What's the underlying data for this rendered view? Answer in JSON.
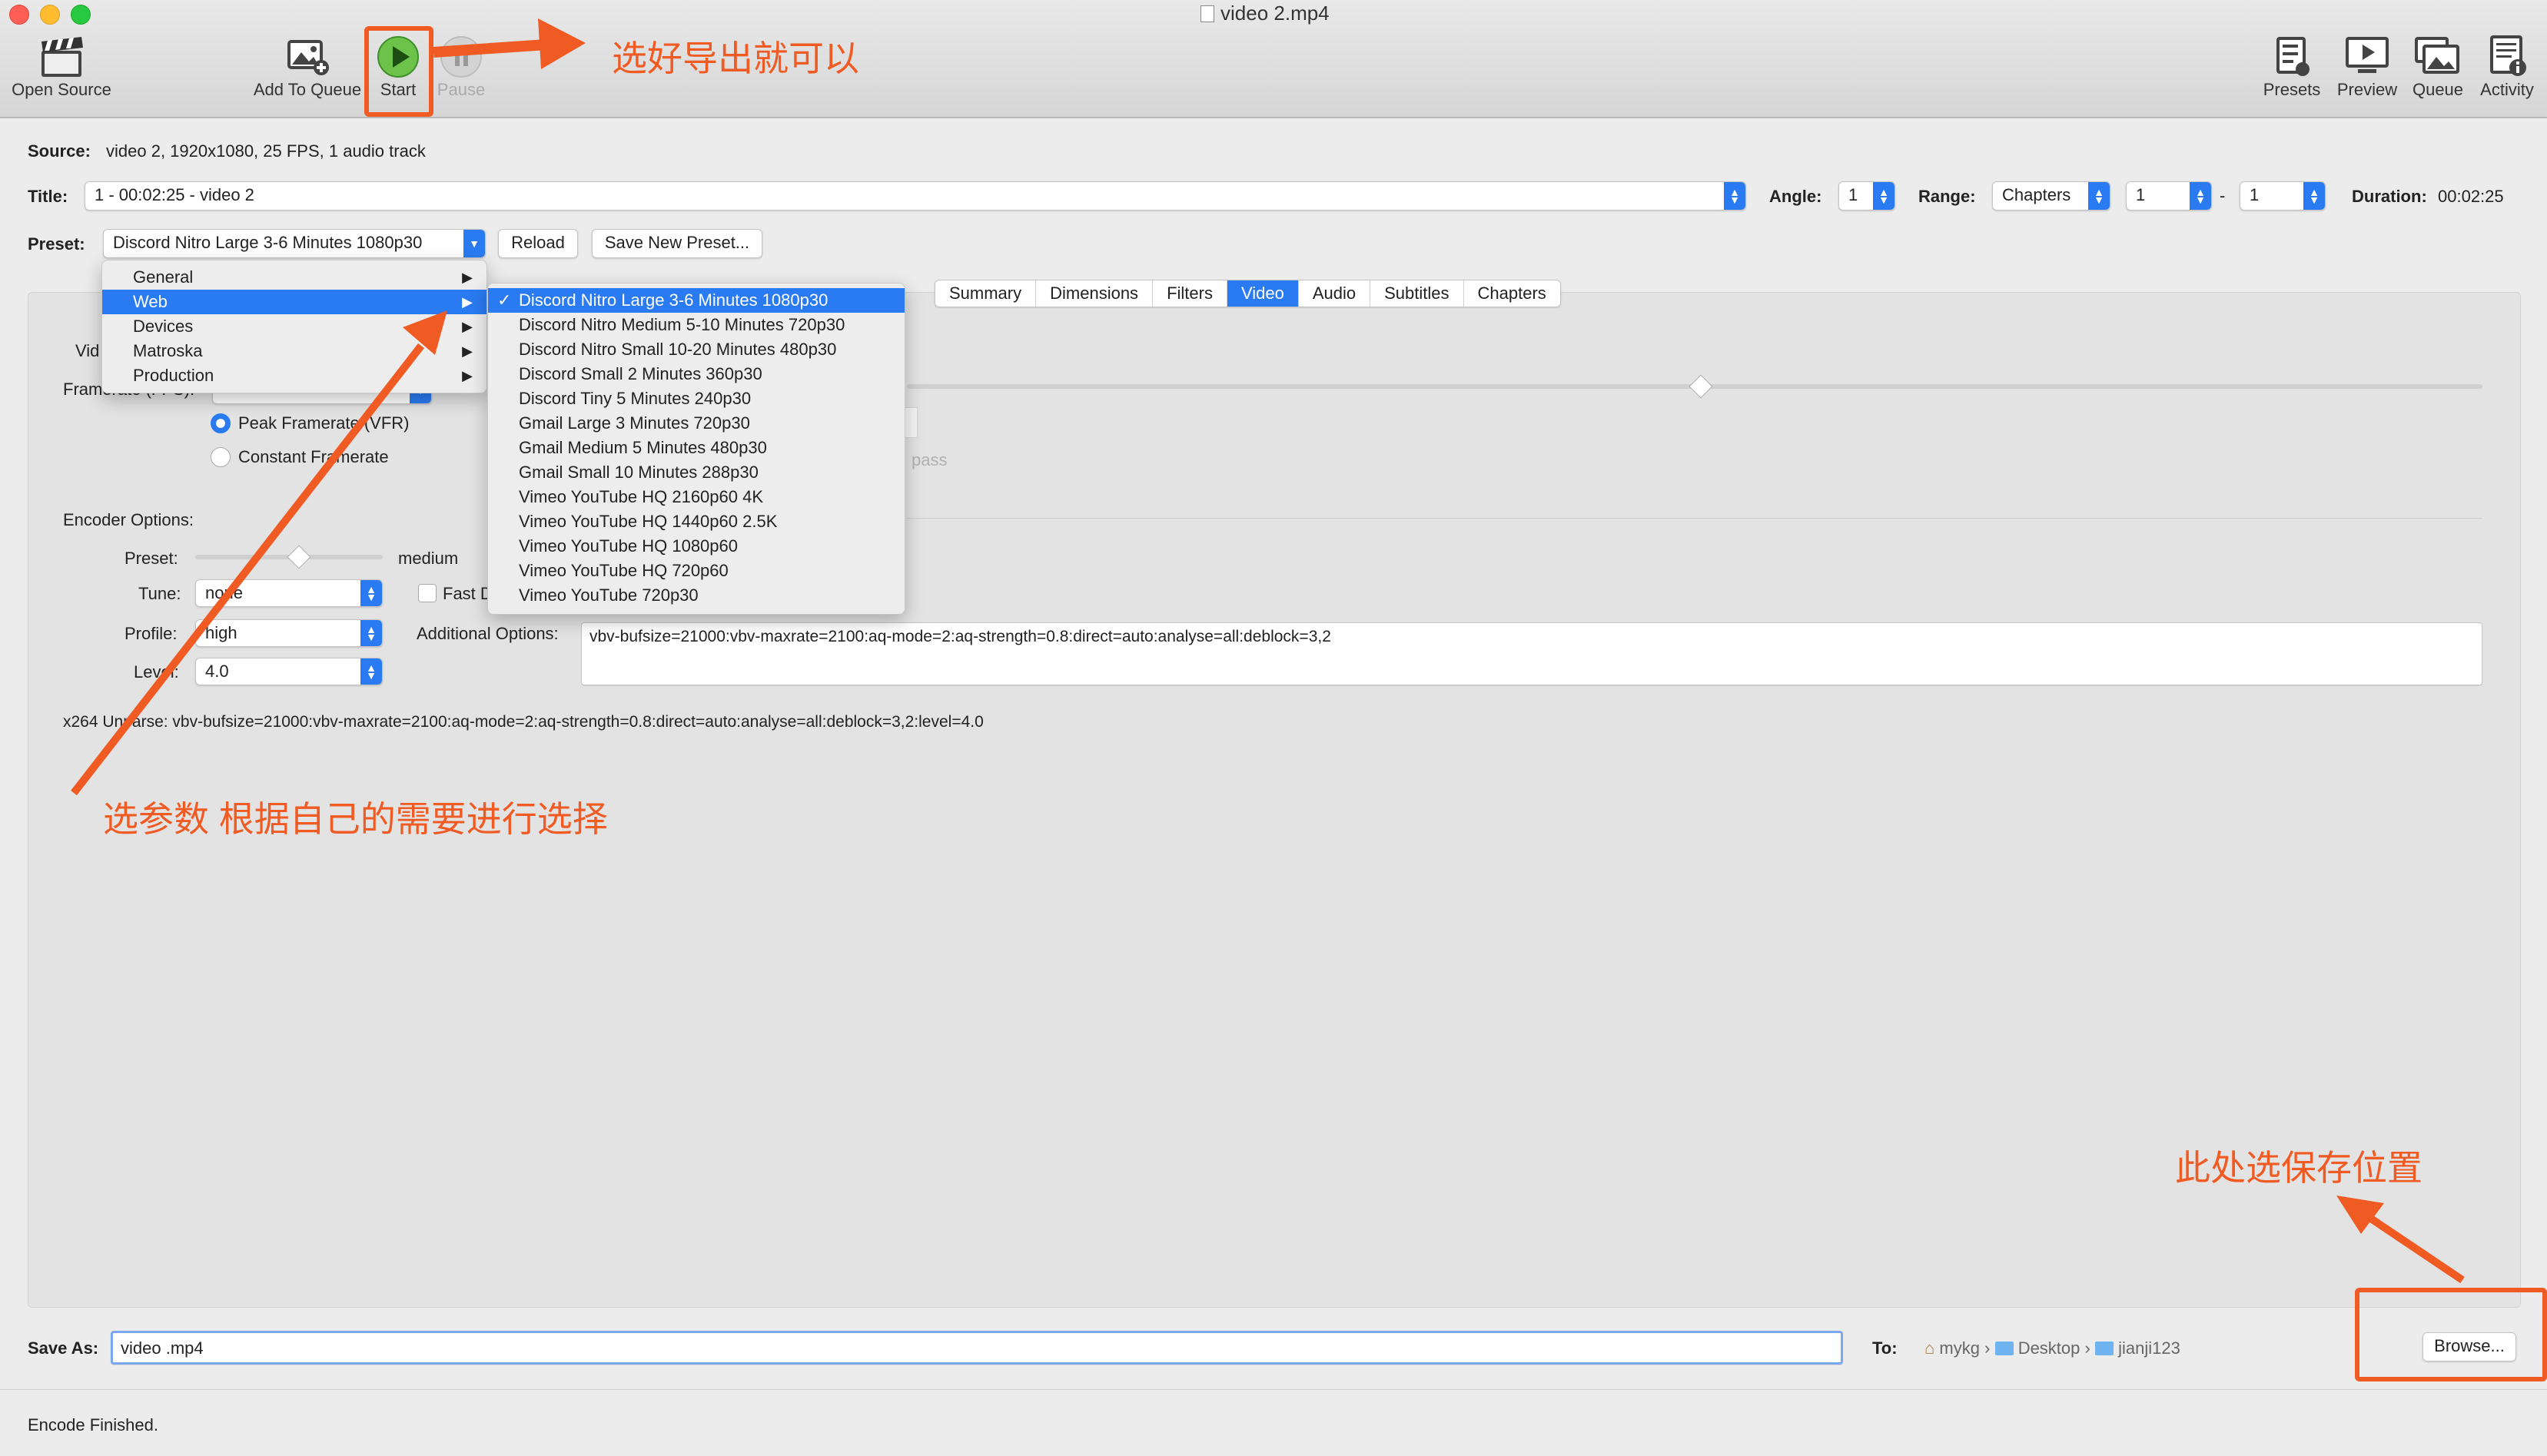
{
  "window": {
    "title": "video 2.mp4"
  },
  "toolbar": {
    "open_source": "Open Source",
    "add_to_queue": "Add To Queue",
    "start": "Start",
    "pause": "Pause",
    "presets": "Presets",
    "preview": "Preview",
    "queue": "Queue",
    "activity": "Activity"
  },
  "source": {
    "label": "Source:",
    "value": "video 2, 1920x1080, 25 FPS, 1 audio track"
  },
  "title_row": {
    "label": "Title:",
    "value": "1 - 00:02:25 - video 2",
    "angle_label": "Angle:",
    "angle_value": "1",
    "range_label": "Range:",
    "range_type": "Chapters",
    "range_from": "1",
    "range_dash": "-",
    "range_to": "1",
    "duration_label": "Duration:",
    "duration_value": "00:02:25"
  },
  "preset_row": {
    "label": "Preset:",
    "value": "Discord Nitro Large 3-6 Minutes 1080p30",
    "reload": "Reload",
    "save_new": "Save New Preset..."
  },
  "tabs": [
    "Summary",
    "Dimensions",
    "Filters",
    "Video",
    "Audio",
    "Subtitles",
    "Chapters"
  ],
  "selected_tab": "Video",
  "video_tab": {
    "video_label_partial": "Vid",
    "framerate_label_partial": "Framerate (FPS):",
    "peak_framerate": "Peak Framerate (VFR)",
    "constant_framerate": "Constant Framerate",
    "pass_partial": "pass",
    "encoder_options": "Encoder Options:",
    "preset_label": "Preset:",
    "preset_value": "medium",
    "tune_label": "Tune:",
    "tune_value": "none",
    "fast_decode_partial": "Fast D",
    "profile_label": "Profile:",
    "profile_value": "high",
    "additional_label": "Additional Options:",
    "additional_value": "vbv-bufsize=21000:vbv-maxrate=2100:aq-mode=2:aq-strength=0.8:direct=auto:analyse=all:deblock=3,2",
    "level_label": "Level:",
    "level_value": "4.0",
    "unparse": "x264 Unparse: vbv-bufsize=21000:vbv-maxrate=2100:aq-mode=2:aq-strength=0.8:direct=auto:analyse=all:deblock=3,2:level=4.0"
  },
  "preset_menu": {
    "categories": [
      "General",
      "Web",
      "Devices",
      "Matroska",
      "Production"
    ],
    "selected_category": "Web",
    "web_items": [
      "Discord Nitro Large 3-6 Minutes 1080p30",
      "Discord Nitro Medium 5-10 Minutes 720p30",
      "Discord Nitro Small 10-20 Minutes 480p30",
      "Discord Small 2 Minutes 360p30",
      "Discord Tiny 5 Minutes 240p30",
      "Gmail Large 3 Minutes 720p30",
      "Gmail Medium 5 Minutes 480p30",
      "Gmail Small 10 Minutes 288p30",
      "Vimeo YouTube HQ 2160p60 4K",
      "Vimeo YouTube HQ 1440p60 2.5K",
      "Vimeo YouTube HQ 1080p60",
      "Vimeo YouTube HQ 720p60",
      "Vimeo YouTube 720p30"
    ],
    "checked_item": "Discord Nitro Large 3-6 Minutes 1080p30"
  },
  "save": {
    "label": "Save As:",
    "value": "video .mp4",
    "to_label": "To:",
    "path": [
      "mykg",
      "Desktop",
      "jianji123"
    ],
    "browse": "Browse..."
  },
  "status": "Encode Finished.",
  "annotations": {
    "export": "选好导出就可以",
    "params": "选参数  根据自己的需要进行选择",
    "save_location": "此处选保存位置"
  },
  "colors": {
    "accent": "#2a7bf1",
    "annotation": "#f05a23",
    "start_green": "#3aa53a"
  }
}
